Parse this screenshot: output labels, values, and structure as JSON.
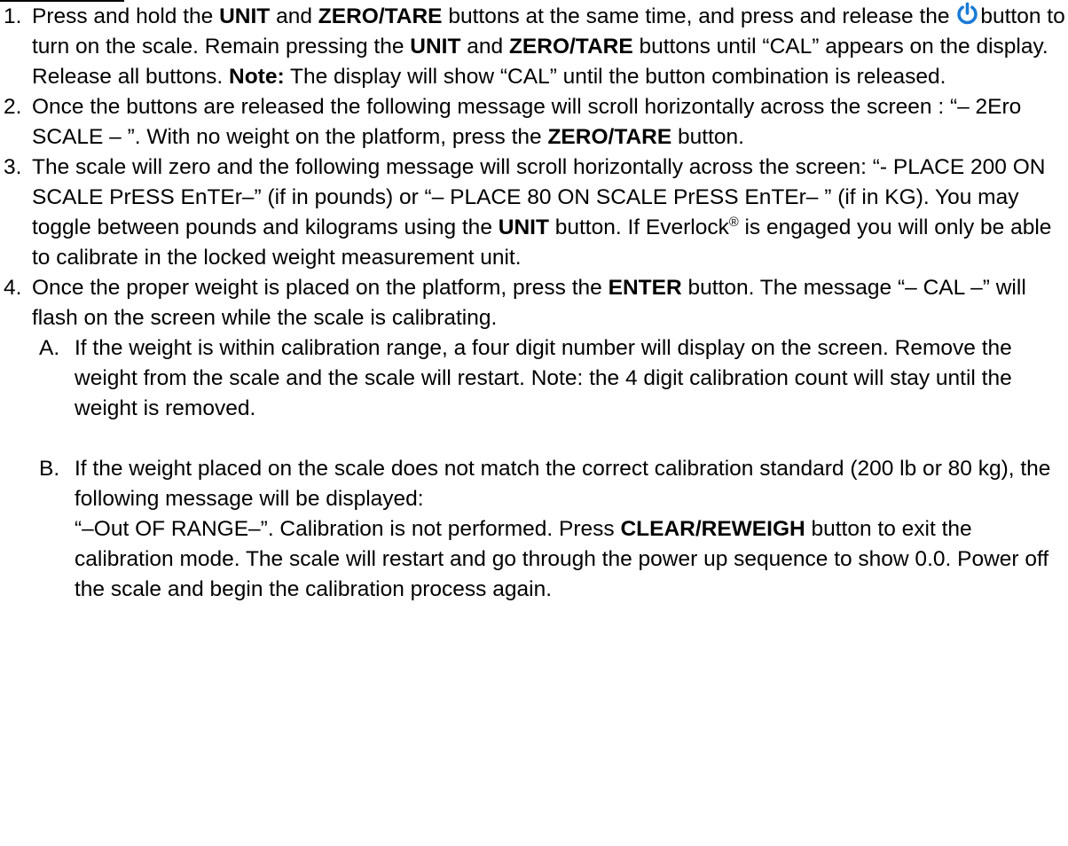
{
  "colors": {
    "power_icon": "#1a7bd6",
    "text": "#000000"
  },
  "icons": {
    "power": "power-icon"
  },
  "steps": [
    {
      "num": "1.",
      "t1": "Press and hold the ",
      "b1": "UNIT",
      "t2": " and ",
      "b2": "ZERO/TARE",
      "t3": " buttons at the same time, and press and release the ",
      "t4": "button to turn on the scale. Remain pressing the ",
      "b3": "UNIT",
      "t5": " and ",
      "b4": "ZERO/TARE",
      "t6": " buttons until “CAL” appears on the display. Release all buttons. ",
      "b5": "Note:",
      "t7": " The display will show “CAL” until the button combination is released."
    },
    {
      "num": "2.",
      "t1": "Once the buttons are released the following message will scroll horizontally across the screen :  “– 2Ero SCALE – ”. With no weight on the platform, press the ",
      "b1": "ZERO/TARE",
      "t2": " button."
    },
    {
      "num": "3.",
      "t1": "The scale will zero and the following message will scroll horizontally across the screen: “- PLACE 200 ON SCALE  PrESS EnTEr–” (if in pounds)  or “– PLACE 80 ON SCALE PrESS EnTEr– ” (if in KG). You may toggle between pounds and kilograms using the ",
      "b1": "UNIT",
      "t2": " button. If Everlock",
      "reg": "®",
      "t3": " is engaged you will only be able to calibrate in the locked weight measurement unit."
    },
    {
      "num": "4.",
      "t1": "Once the proper weight is placed on the platform, press the ",
      "b1": "ENTER",
      "t2": " button. The message “– CAL –” will flash on the screen while the scale is calibrating.",
      "sub": [
        {
          "letter": "A.",
          "t1": "If the weight is within calibration range, a four digit number will display on the screen. Remove the weight from the scale and the scale will restart. Note: the 4 digit calibration count will stay until the weight is removed."
        },
        {
          "letter": "B.",
          "t1": "If the weight placed on the scale does not match the correct calibration standard (200 lb or 80 kg), the following message will be displayed:",
          "t2": "“–Out OF RANGE–”.  Calibration is not performed. Press ",
          "b1": "CLEAR/REWEIGH",
          "t3": " button to exit the calibration mode. The scale will restart and go through the power up sequence to show 0.0. Power off the scale and begin the calibration process again."
        }
      ]
    }
  ]
}
